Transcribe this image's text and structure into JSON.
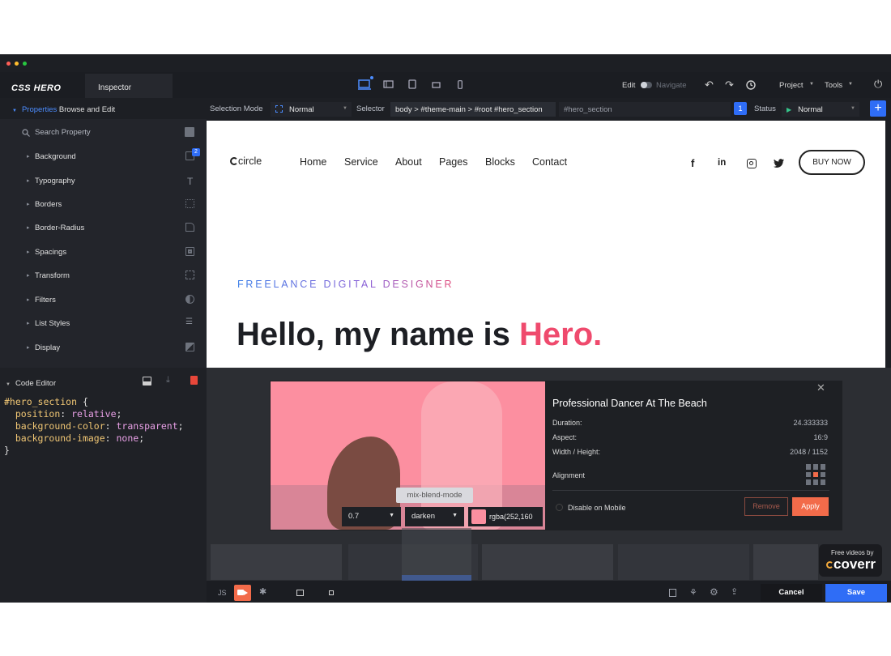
{
  "window": {
    "traffic_colors": [
      "#ff5f57",
      "#ffbd2e",
      "#28c840"
    ]
  },
  "topbar": {
    "logo": "CSS HERO",
    "tab": "Inspector",
    "edit_label": "Edit",
    "navigate_label": "Navigate",
    "project_label": "Project",
    "tools_label": "Tools"
  },
  "toolbar": {
    "selection_mode_label": "Selection Mode",
    "selection_mode_value": "Normal",
    "selector_label": "Selector",
    "selector_path": "body > #theme-main > #root #hero_section",
    "selector_id": "#hero_section",
    "count_badge": "1",
    "status_label": "Status",
    "status_value": "Normal"
  },
  "properties_panel": {
    "header_link": "Properties",
    "header_rest": "Browse and Edit",
    "search_placeholder": "Search Property",
    "background_badge": "2",
    "items": [
      {
        "label": "Background"
      },
      {
        "label": "Typography"
      },
      {
        "label": "Borders"
      },
      {
        "label": "Border-Radius"
      },
      {
        "label": "Spacings"
      },
      {
        "label": "Transform"
      },
      {
        "label": "Filters"
      },
      {
        "label": "List Styles"
      },
      {
        "label": "Display"
      }
    ]
  },
  "code_editor": {
    "title": "Code Editor",
    "selector": "#hero_section",
    "lines": [
      {
        "prop": "position",
        "val": "relative"
      },
      {
        "prop": "background-color",
        "val": "transparent"
      },
      {
        "prop": "background-image",
        "val": "none"
      }
    ]
  },
  "site": {
    "logo": "circle",
    "nav": [
      "Home",
      "Service",
      "About",
      "Pages",
      "Blocks",
      "Contact"
    ],
    "buy_button": "BUY NOW",
    "tagline": "FREELANCE DIGITAL DESIGNER",
    "heading_start": "Hello, my name is ",
    "heading_highlight": "Hero.",
    "accent": "#ef4a6d"
  },
  "video_modal": {
    "title": "Professional Dancer At The Beach",
    "duration_label": "Duration:",
    "duration_value": "24.333333",
    "aspect_label": "Aspect:",
    "aspect_value": "16:9",
    "size_label": "Width / Height:",
    "size_value": "2048 / 1152",
    "alignment_label": "Alignment",
    "mobile_label": "Disable on Mobile",
    "remove_button": "Remove",
    "apply_button": "Apply",
    "opacity_value": "0.7",
    "blend_tooltip": "mix-blend-mode",
    "blend_value": "darken",
    "color_value": "rgba(252,160",
    "overlay_color": "#fc8fa0"
  },
  "coverr": {
    "small": "Free videos by",
    "brand": "coverr"
  },
  "bottom_bar": {
    "js_label": "JS",
    "cancel_button": "Cancel",
    "save_button": "Save"
  },
  "colors": {
    "accent_blue": "#2f6df6",
    "orange": "#f26b4a"
  }
}
